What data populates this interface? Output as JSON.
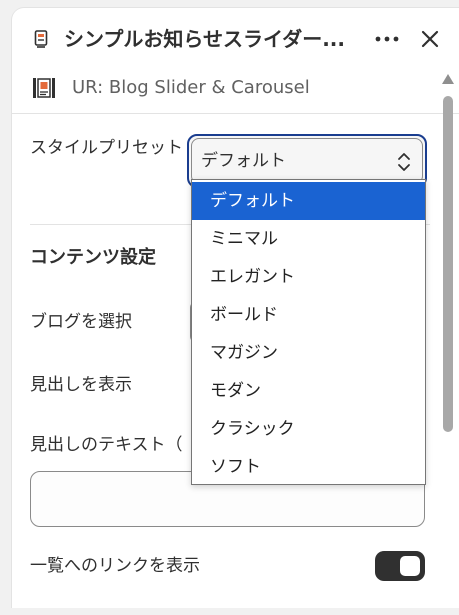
{
  "header": {
    "title": "シンプルお知らせスライダー...",
    "more_label": "•••",
    "icon": "receipt-icon"
  },
  "subheader": {
    "text": "UR: Blog Slider & Carousel",
    "icon": "film-strip-icon"
  },
  "settings": {
    "style_preset_label": "スタイルプリセット",
    "style_preset_value": "デフォルト",
    "content_section_title": "コンテンツ設定",
    "select_blog_label": "ブログを選択",
    "show_heading_label": "見出しを表示",
    "heading_text_label": "見出しのテキスト（",
    "heading_text_value": "",
    "show_list_link_label": "一覧へのリンクを表示",
    "show_list_link_on": true
  },
  "dropdown": {
    "options": [
      "デフォルト",
      "ミニマル",
      "エレガント",
      "ボールド",
      "マガジン",
      "モダン",
      "クラシック",
      "ソフト"
    ],
    "selected_index": 0
  },
  "colors": {
    "accent": "#1a63d2",
    "focus_border": "#1a3d8f",
    "toggle_on": "#303030"
  }
}
